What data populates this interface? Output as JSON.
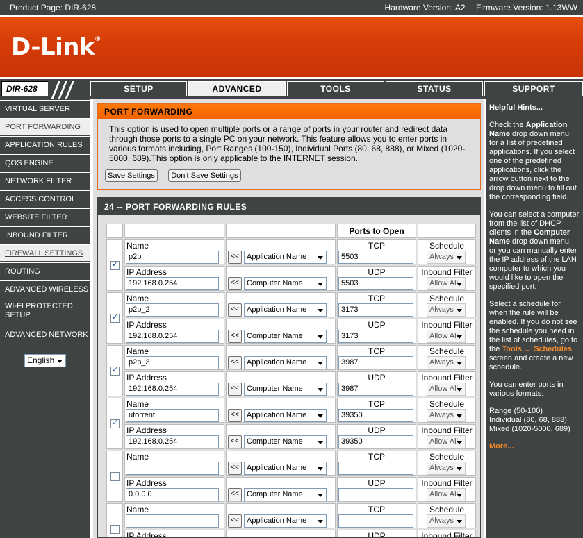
{
  "topbar": {
    "product": "Product Page: DIR-628",
    "hardware": "Hardware Version: A2",
    "firmware": "Firmware Version: 1.13WW"
  },
  "brand": {
    "logo": "D-Link",
    "registered": "®"
  },
  "model_badge": "DIR-628",
  "nav": {
    "tabs": [
      {
        "label": "SETUP",
        "active": false
      },
      {
        "label": "ADVANCED",
        "active": true
      },
      {
        "label": "TOOLS",
        "active": false
      },
      {
        "label": "STATUS",
        "active": false
      },
      {
        "label": "SUPPORT",
        "active": false
      }
    ]
  },
  "sidebar": {
    "items": [
      {
        "label": "VIRTUAL SERVER"
      },
      {
        "label": "PORT FORWARDING"
      },
      {
        "label": "APPLICATION RULES"
      },
      {
        "label": "QOS ENGINE"
      },
      {
        "label": "NETWORK FILTER"
      },
      {
        "label": "ACCESS CONTROL"
      },
      {
        "label": "WEBSITE FILTER"
      },
      {
        "label": "INBOUND FILTER"
      },
      {
        "label": "FIREWALL SETTINGS"
      },
      {
        "label": "ROUTING"
      },
      {
        "label": "ADVANCED WIRELESS"
      },
      {
        "label": "WI-FI PROTECTED SETUP"
      },
      {
        "label": "ADVANCED NETWORK"
      }
    ],
    "language": "English"
  },
  "port_forwarding": {
    "title": "PORT FORWARDING",
    "description": "This option is used to open multiple ports or a range of ports in your router and redirect data through those ports to a single PC on your network. This feature allows you to enter ports in various formats including, Port Ranges (100-150), Individual Ports (80, 68, 888), or Mixed (1020-5000, 689).This option is only applicable to the INTERNET session.",
    "save_label": "Save Settings",
    "dont_save_label": "Don't Save Settings"
  },
  "rules": {
    "title": "24 -- PORT FORWARDING RULES",
    "ports_header": "Ports to Open",
    "name_label": "Name",
    "ip_label": "IP Address",
    "tcp_label": "TCP",
    "udp_label": "UDP",
    "schedule_label": "Schedule",
    "inbound_label": "Inbound Filter",
    "arrow_label": "<<",
    "app_select": "Application Name",
    "computer_select": "Computer Name",
    "schedule_value": "Always",
    "inbound_value": "Allow All",
    "rows": [
      {
        "checked": true,
        "name": "p2p",
        "ip": "192.168.0.254",
        "tcp": "5503",
        "udp": "5503"
      },
      {
        "checked": true,
        "name": "p2p_2",
        "ip": "192.168.0.254",
        "tcp": "3173",
        "udp": "3173"
      },
      {
        "checked": true,
        "name": "p2p_3",
        "ip": "192.168.0.254",
        "tcp": "3987",
        "udp": "3987"
      },
      {
        "checked": true,
        "name": "utorrent",
        "ip": "192.168.0.254",
        "tcp": "39350",
        "udp": "39350"
      },
      {
        "checked": false,
        "name": "",
        "ip": "0.0.0.0",
        "tcp": "",
        "udp": ""
      },
      {
        "checked": false,
        "name": "",
        "ip": "",
        "tcp": "",
        "udp": ""
      }
    ]
  },
  "hints": {
    "title": "Helpful Hints...",
    "p1_a": "Check the ",
    "p1_b": "Application Name",
    "p1_c": " drop down menu for a list of predefined applications. If you select one of the predefined applications, click the arrow button next to the drop down menu to fill out the corresponding field.",
    "p2_a": "You can select a computer from the list of DHCP clients in the ",
    "p2_b": "Computer Name",
    "p2_c": " drop down menu, or you can manually enter the IP address of the LAN computer to which you would like to open the specified port.",
    "p3_a": "Select a schedule for when the rule will be enabled. If you do not see the schedule you need in the list of schedules, go to the ",
    "p3_link": "Tools → Schedules",
    "p3_c": " screen and create a new schedule.",
    "p4": "You can enter ports in various formats:",
    "f1": "Range (50-100)",
    "f2": "Individual (80, 68, 888)",
    "f3": "Mixed (1020-5000, 689)",
    "more": "More..."
  }
}
